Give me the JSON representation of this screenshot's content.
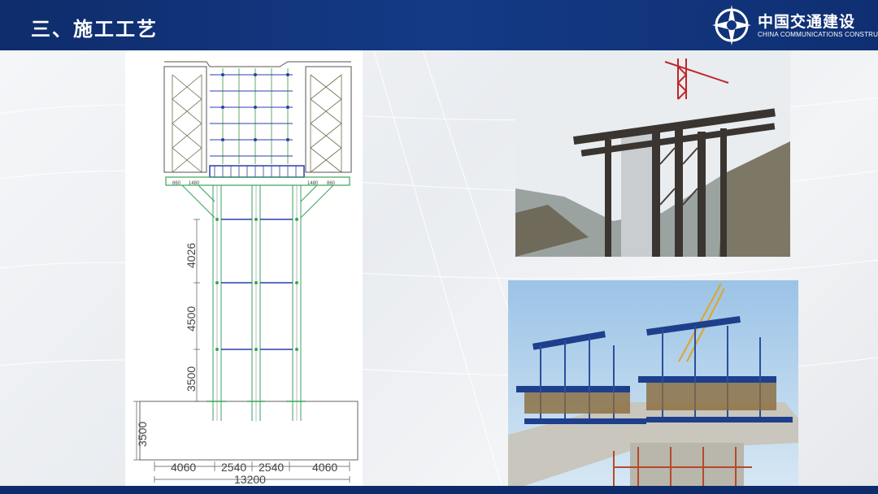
{
  "header": {
    "title": "三、施工工艺",
    "logo_cn": "中国交通建设",
    "logo_en": "CHINA COMMUNICATIONS CONSTRUCTION",
    "bar_color": "#123580"
  },
  "drawing": {
    "vertical_dims": [
      "4026",
      "4500",
      "3500",
      "3500"
    ],
    "bottom_dims": [
      "4060",
      "2540",
      "2540",
      "4060"
    ],
    "total_width": "13200",
    "beam_labels": [
      "860",
      "1480",
      "1480",
      "860"
    ]
  },
  "photos": [
    {
      "icon": "pier-scaffold-photo"
    },
    {
      "icon": "cantilever-formwork-photo"
    }
  ]
}
